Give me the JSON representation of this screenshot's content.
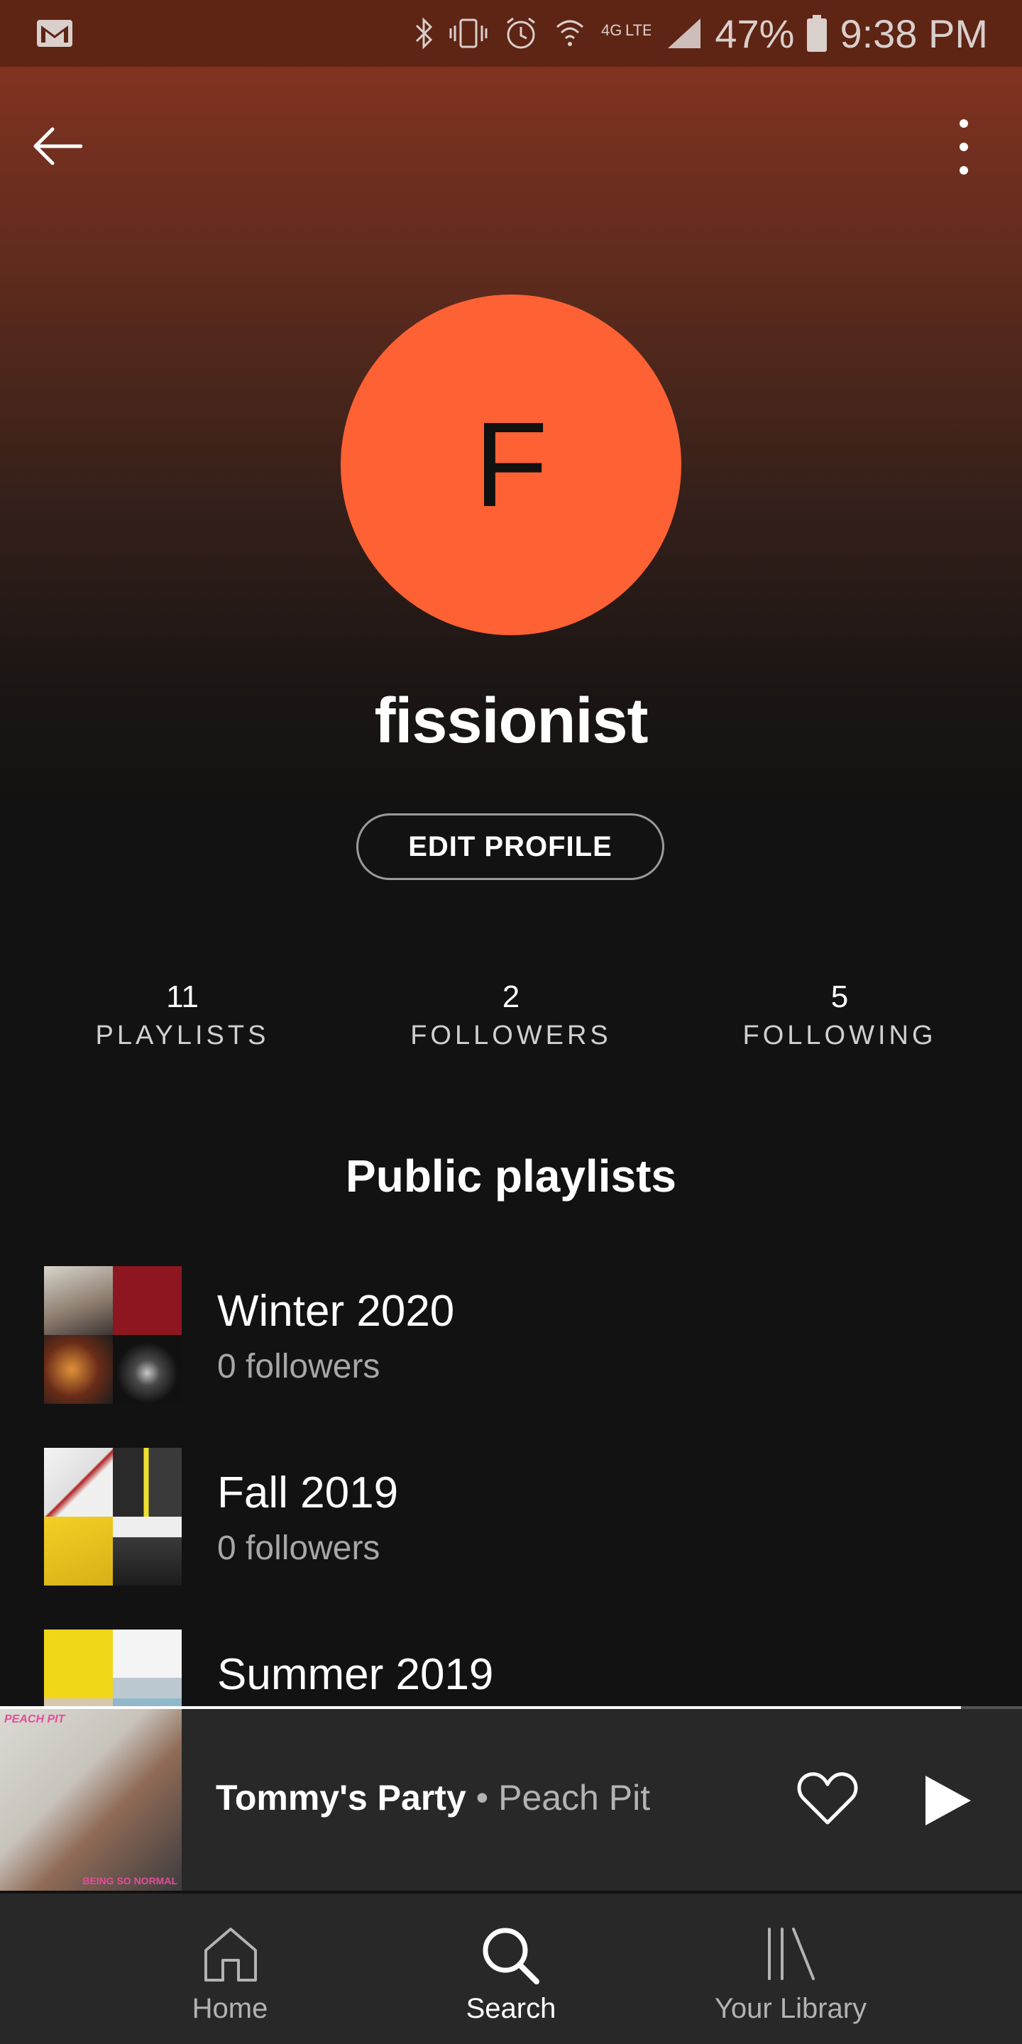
{
  "status_bar": {
    "battery": "47%",
    "time": "9:38 PM"
  },
  "profile": {
    "avatar_initial": "F",
    "avatar_color": "#fe6133",
    "username": "fissionist",
    "edit_label": "EDIT PROFILE"
  },
  "stats": [
    {
      "count": "11",
      "label": "PLAYLISTS"
    },
    {
      "count": "2",
      "label": "FOLLOWERS"
    },
    {
      "count": "5",
      "label": "FOLLOWING"
    }
  ],
  "section": {
    "title": "Public playlists"
  },
  "playlists": [
    {
      "name": "Winter 2020",
      "followers": "0 followers"
    },
    {
      "name": "Fall 2019",
      "followers": "0 followers"
    },
    {
      "name": "Summer 2019",
      "followers": ""
    }
  ],
  "now_playing": {
    "title": "Tommy's Party",
    "separator": "•",
    "artist": "Peach Pit",
    "art_text_top": "PEACH PIT",
    "art_text_bottom": "BEING SO NORMAL",
    "progress": 0.94
  },
  "nav": [
    {
      "label": "Home",
      "icon": "home-icon"
    },
    {
      "label": "Search",
      "icon": "search-icon",
      "active": true
    },
    {
      "label": "Your Library",
      "icon": "library-icon"
    }
  ]
}
